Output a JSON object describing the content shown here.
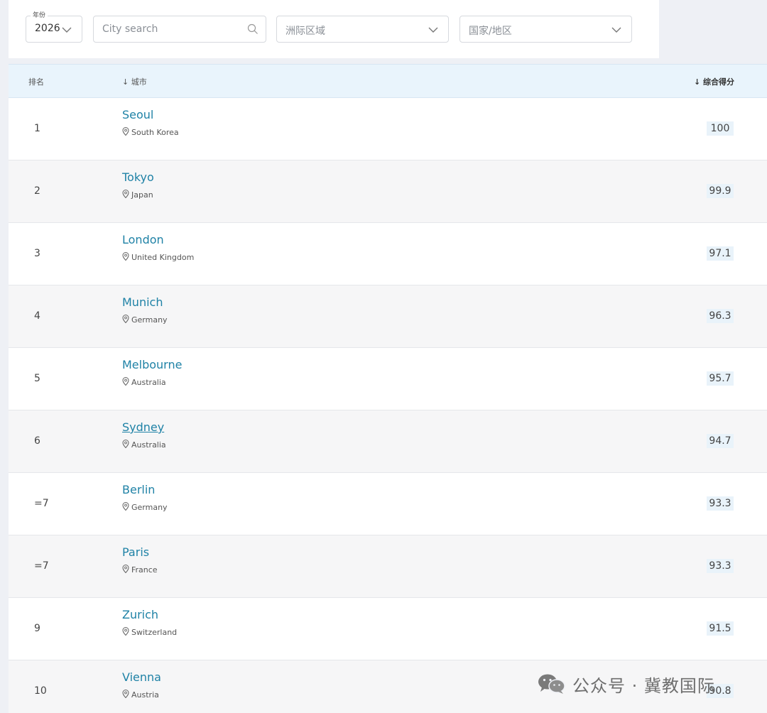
{
  "filters": {
    "year_label": "年份",
    "year_value": "2026",
    "city_search_placeholder": "City search",
    "region_placeholder": "洲际区域",
    "country_placeholder": "国家/地区"
  },
  "table": {
    "headers": {
      "rank": "排名",
      "city": "↓ 城市",
      "score": "↓ 综合得分"
    },
    "rows": [
      {
        "rank": "1",
        "city": "Seoul",
        "country": "South Korea",
        "score": "100"
      },
      {
        "rank": "2",
        "city": "Tokyo",
        "country": "Japan",
        "score": "99.9"
      },
      {
        "rank": "3",
        "city": "London",
        "country": "United Kingdom",
        "score": "97.1"
      },
      {
        "rank": "4",
        "city": "Munich",
        "country": "Germany",
        "score": "96.3"
      },
      {
        "rank": "5",
        "city": "Melbourne",
        "country": "Australia",
        "score": "95.7"
      },
      {
        "rank": "6",
        "city": "Sydney",
        "country": "Australia",
        "score": "94.7"
      },
      {
        "rank": "=7",
        "city": "Berlin",
        "country": "Germany",
        "score": "93.3"
      },
      {
        "rank": "=7",
        "city": "Paris",
        "country": "France",
        "score": "93.3"
      },
      {
        "rank": "9",
        "city": "Zurich",
        "country": "Switzerland",
        "score": "91.5"
      },
      {
        "rank": "10",
        "city": "Vienna",
        "country": "Austria",
        "score": "90.8"
      }
    ]
  },
  "watermark": {
    "text": "公众号 · 冀教国际"
  },
  "colors": {
    "link": "#1f82a6",
    "header_bg": "#e9f4fc",
    "score_bg": "#e9f3fa"
  }
}
